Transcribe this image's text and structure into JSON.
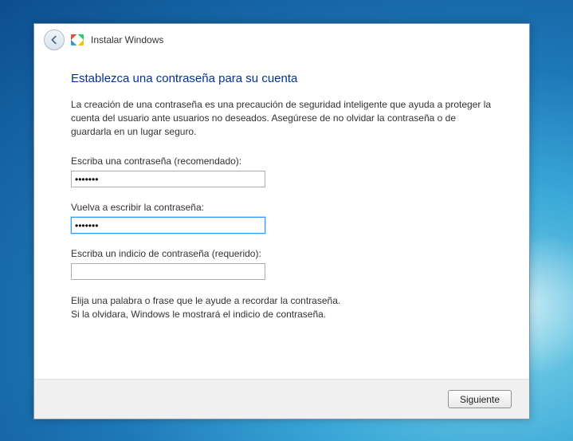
{
  "titlebar": {
    "title": "Instalar Windows"
  },
  "heading": "Establezca una contraseña para su cuenta",
  "description": "La creación de una contraseña es una precaución de seguridad inteligente que ayuda a proteger la cuenta del usuario ante usuarios no deseados. Asegúrese de no olvidar la contraseña o de guardarla en un lugar seguro.",
  "fields": {
    "password": {
      "label": "Escriba una contraseña (recomendado):",
      "value": "•••••••"
    },
    "confirm": {
      "label": "Vuelva a escribir la contraseña:",
      "value": "•••••••"
    },
    "hint": {
      "label": "Escriba un indicio de contraseña (requerido):",
      "value": ""
    }
  },
  "hint_text": "Elija una palabra o frase que le ayude a recordar la contraseña.\nSi la olvidara, Windows le mostrará el indicio de contraseña.",
  "buttons": {
    "next": "Siguiente"
  }
}
